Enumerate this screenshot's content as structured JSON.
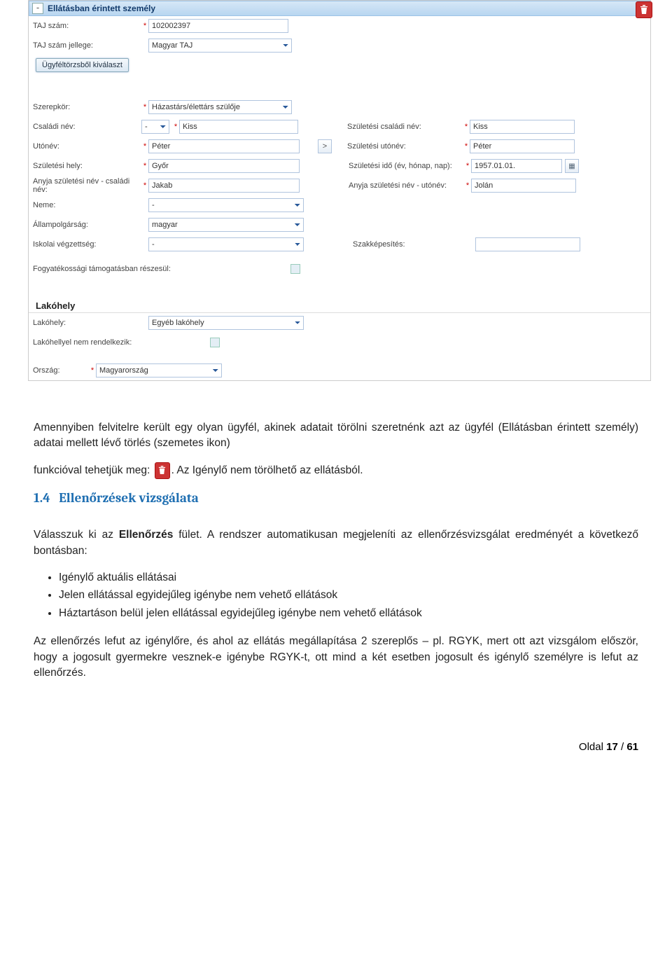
{
  "section": {
    "title": "Ellátásban érintett személy",
    "collapse_glyph": "-",
    "delete_title": "Törlés"
  },
  "form": {
    "taj_label": "TAJ szám:",
    "taj_value": "102002397",
    "taj_jelleg_label": "TAJ szám jellege:",
    "taj_jelleg_value": "Magyar TAJ",
    "choose_btn": "Ügyféltörzsből kiválaszt",
    "szerepkor_label": "Szerepkör:",
    "szerepkor_value": "Házastárs/élettárs szülője",
    "csaladi_label": "Családi név:",
    "prefix_value": "-",
    "csaladi_value": "Kiss",
    "szul_csaladi_label": "Születési családi név:",
    "szul_csaladi_value": "Kiss",
    "utonev_label": "Utónév:",
    "utonev_value": "Péter",
    "copy_btn": ">",
    "szul_utonev_label": "Születési utónév:",
    "szul_utonev_value": "Péter",
    "szul_hely_label": "Születési hely:",
    "szul_hely_value": "Győr",
    "szul_ido_label": "Születési idő (év, hónap, nap):",
    "szul_ido_value": "1957.01.01.",
    "anyja_csal_label": "Anyja születési név - családi név:",
    "anyja_csal_value": "Jakab",
    "anyja_uto_label": "Anyja születési név - utónév:",
    "anyja_uto_value": "Jolán",
    "neme_label": "Neme:",
    "neme_value": "-",
    "allampolg_label": "Állampolgárság:",
    "allampolg_value": "magyar",
    "iskolai_label": "Iskolai végzettség:",
    "iskolai_value": "-",
    "szakkep_label": "Szakképesítés:",
    "fogyatek_label": "Fogyatékossági támogatásban részesül:",
    "lakohely_header": "Lakóhely",
    "lakohely_label": "Lakóhely:",
    "lakohely_value": "Egyéb lakóhely",
    "nemrend_label": "Lakóhellyel nem rendelkezik:",
    "orszag_label": "Ország:",
    "orszag_value": "Magyarország"
  },
  "doc": {
    "p1a": "Amennyiben felvitelre került egy olyan ügyfél, akinek adatait törölni szeretnénk azt az ügyfél (Ellátásban érintett személy) adatai mellett lévő törlés (szemetes ikon)",
    "p1b_prefix": "funkcióval tehetjük meg: ",
    "p1b_suffix": ". Az Igénylő nem törölhető az ellátásból.",
    "h14_num": "1.4",
    "h14_title": "Ellenőrzések vizsgálata",
    "p2": "Válasszuk ki az Ellenőrzés fület. A rendszer automatikusan megjeleníti az ellenőrzésvizsgálat eredményét a következő bontásban:",
    "p2_bold1": "Ellenőrzés",
    "bullets": [
      "Igénylő aktuális ellátásai",
      "Jelen ellátással egyidejűleg igénybe nem vehető ellátások",
      "Háztartáson belül jelen ellátással egyidejűleg igénybe nem vehető ellátások"
    ],
    "p3": "Az ellenőrzés lefut az igénylőre, és ahol az ellátás megállapítása 2 szereplős – pl. RGYK, mert ott azt vizsgálom először, hogy a jogosult gyermekre vesznek-e igénybe RGYK-t, ott mind a két esetben jogosult és igénylő személyre is lefut az ellenőrzés."
  },
  "footer": {
    "prefix": "Oldal ",
    "page": "17",
    "sep": " / ",
    "total": "61"
  }
}
